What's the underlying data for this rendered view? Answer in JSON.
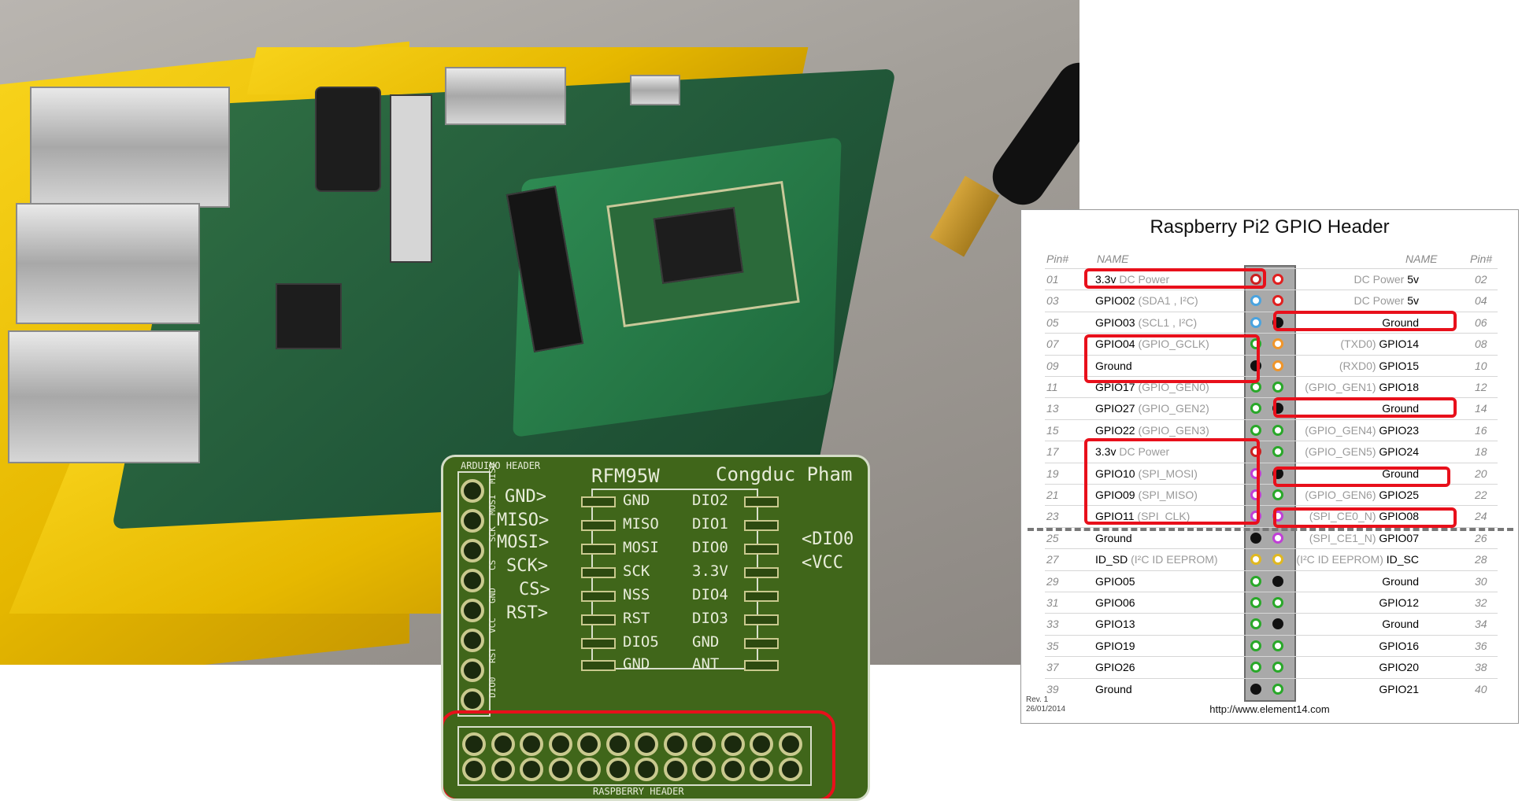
{
  "shield": {
    "arduino_header": "ARDUINO HEADER",
    "raspberry_header": "RASPBERRY HEADER",
    "module_name": "RFM95W",
    "author": "Congduc Pham",
    "left_header_pins": [
      "MISO",
      "MOSI",
      "SCK",
      "CS",
      "GND",
      "VCC",
      "RST",
      "DIO0"
    ],
    "left_arrows": [
      "GND>",
      "MISO>",
      "MOSI>",
      "SCK>",
      "CS>",
      "RST>"
    ],
    "module_left_pins": [
      "GND",
      "MISO",
      "MOSI",
      "SCK",
      "NSS",
      "RST",
      "DIO5",
      "GND"
    ],
    "module_right_pins": [
      "DIO2",
      "DIO1",
      "DIO0",
      "3.3V",
      "DIO4",
      "DIO3",
      "GND",
      "ANT"
    ],
    "right_arrows": [
      "<DIO0",
      "<VCC"
    ]
  },
  "gpio": {
    "title": "Raspberry Pi2 GPIO Header",
    "col_pin": "Pin#",
    "col_name_left": "NAME",
    "col_name_right": "NAME",
    "rev": "Rev. 1",
    "date": "26/01/2014",
    "url": "http://www.element14.com",
    "rows": [
      {
        "lp": "01",
        "ln": "3.3v",
        "lm": " DC Power",
        "lc": "#cc2020",
        "rc": "#e02020",
        "rm": "DC Power ",
        "rn": "5v",
        "rp": "02"
      },
      {
        "lp": "03",
        "ln": "GPIO02",
        "lm": " (SDA1 , I²C)",
        "lc": "#4aa3df",
        "rc": "#e02020",
        "rm": "DC Power ",
        "rn": "5v",
        "rp": "04"
      },
      {
        "lp": "05",
        "ln": "GPIO03",
        "lm": " (SCL1 , I²C)",
        "lc": "#4aa3df",
        "rc": "#111111",
        "rm": "",
        "rn": "Ground",
        "rp": "06"
      },
      {
        "lp": "07",
        "ln": "GPIO04",
        "lm": " (GPIO_GCLK)",
        "lc": "#29a829",
        "rc": "#f0952a",
        "rm": "(TXD0) ",
        "rn": "GPIO14",
        "rp": "08"
      },
      {
        "lp": "09",
        "ln": "Ground",
        "lm": "",
        "lc": "#111111",
        "rc": "#f0952a",
        "rm": "(RXD0) ",
        "rn": "GPIO15",
        "rp": "10"
      },
      {
        "lp": "11",
        "ln": "GPIO17",
        "lm": " (GPIO_GEN0)",
        "lc": "#29a829",
        "rc": "#29a829",
        "rm": "(GPIO_GEN1) ",
        "rn": "GPIO18",
        "rp": "12"
      },
      {
        "lp": "13",
        "ln": "GPIO27",
        "lm": " (GPIO_GEN2)",
        "lc": "#29a829",
        "rc": "#111111",
        "rm": "",
        "rn": "Ground",
        "rp": "14"
      },
      {
        "lp": "15",
        "ln": "GPIO22",
        "lm": " (GPIO_GEN3)",
        "lc": "#29a829",
        "rc": "#29a829",
        "rm": "(GPIO_GEN4) ",
        "rn": "GPIO23",
        "rp": "16"
      },
      {
        "lp": "17",
        "ln": "3.3v",
        "lm": " DC Power",
        "lc": "#cc2020",
        "rc": "#29a829",
        "rm": "(GPIO_GEN5) ",
        "rn": "GPIO24",
        "rp": "18"
      },
      {
        "lp": "19",
        "ln": "GPIO10",
        "lm": " (SPI_MOSI)",
        "lc": "#c03fd6",
        "rc": "#111111",
        "rm": "",
        "rn": "Ground",
        "rp": "20"
      },
      {
        "lp": "21",
        "ln": "GPIO09",
        "lm": " (SPI_MISO)",
        "lc": "#c03fd6",
        "rc": "#29a829",
        "rm": "(GPIO_GEN6) ",
        "rn": "GPIO25",
        "rp": "22"
      },
      {
        "lp": "23",
        "ln": "GPIO11",
        "lm": " (SPI_CLK)",
        "lc": "#c03fd6",
        "rc": "#c03fd6",
        "rm": "(SPI_CE0_N) ",
        "rn": "GPIO08",
        "rp": "24"
      },
      {
        "lp": "25",
        "ln": "Ground",
        "lm": "",
        "lc": "#111111",
        "rc": "#c03fd6",
        "rm": "(SPI_CE1_N) ",
        "rn": "GPIO07",
        "rp": "26"
      },
      {
        "lp": "27",
        "ln": "ID_SD",
        "lm": " (I²C ID EEPROM)",
        "lc": "#e0b820",
        "rc": "#e0b820",
        "rm": "(I²C ID EEPROM) ",
        "rn": "ID_SC",
        "rp": "28"
      },
      {
        "lp": "29",
        "ln": "GPIO05",
        "lm": "",
        "lc": "#29a829",
        "rc": "#111111",
        "rm": "",
        "rn": "Ground",
        "rp": "30"
      },
      {
        "lp": "31",
        "ln": "GPIO06",
        "lm": "",
        "lc": "#29a829",
        "rc": "#29a829",
        "rm": "",
        "rn": "GPIO12",
        "rp": "32"
      },
      {
        "lp": "33",
        "ln": "GPIO13",
        "lm": "",
        "lc": "#29a829",
        "rc": "#111111",
        "rm": "",
        "rn": "Ground",
        "rp": "34"
      },
      {
        "lp": "35",
        "ln": "GPIO19",
        "lm": "",
        "lc": "#29a829",
        "rc": "#29a829",
        "rm": "",
        "rn": "GPIO16",
        "rp": "36"
      },
      {
        "lp": "37",
        "ln": "GPIO26",
        "lm": "",
        "lc": "#29a829",
        "rc": "#29a829",
        "rm": "",
        "rn": "GPIO20",
        "rp": "38"
      },
      {
        "lp": "39",
        "ln": "Ground",
        "lm": "",
        "lc": "#111111",
        "rc": "#29a829",
        "rm": "",
        "rn": "GPIO21",
        "rp": "40"
      }
    ]
  }
}
